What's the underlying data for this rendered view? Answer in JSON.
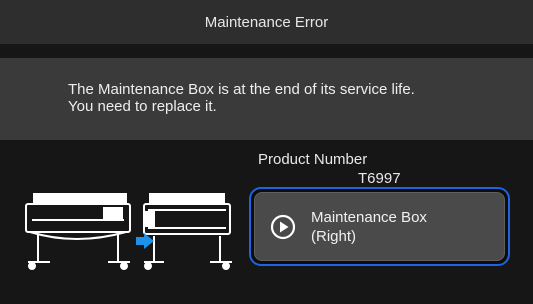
{
  "header": {
    "title": "Maintenance Error"
  },
  "message": {
    "text": "The Maintenance Box is at the end of its service life.\nYou need to replace it."
  },
  "product": {
    "label": "Product Number",
    "number": "T6997"
  },
  "action_button": {
    "label": "Maintenance Box\n(Right)",
    "icon": "play-circle-icon"
  },
  "colors": {
    "accent": "#1e63e0",
    "arrow": "#1e90e8"
  }
}
